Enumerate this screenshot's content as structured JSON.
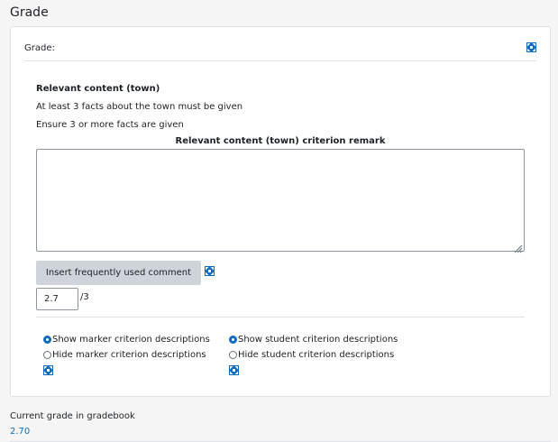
{
  "section": {
    "title": "Grade"
  },
  "card": {
    "header_label": "Grade:",
    "criterion": {
      "title": "Relevant content (town)",
      "description_line1": "At least 3 facts about the town must be given",
      "description_line2": "Ensure 3 or more facts are given",
      "remark_label": "Relevant content (town) criterion remark",
      "remark_value": ""
    },
    "insert_comment_button": "Insert frequently used comment",
    "score": {
      "value": "2.7",
      "max": "/3"
    },
    "options": {
      "show_marker": "Show marker criterion descriptions",
      "hide_marker": "Hide marker criterion descriptions",
      "show_student": "Show student criterion descriptions",
      "hide_student": "Hide student criterion descriptions",
      "show_marker_checked": true,
      "show_student_checked": true
    }
  },
  "gradebook": {
    "label": "Current grade in gradebook",
    "value": "2.70"
  },
  "icons": {
    "expand": "expand-arrows-icon"
  },
  "colors": {
    "accent": "#0f6cbf",
    "button_bg": "#ced4da"
  }
}
